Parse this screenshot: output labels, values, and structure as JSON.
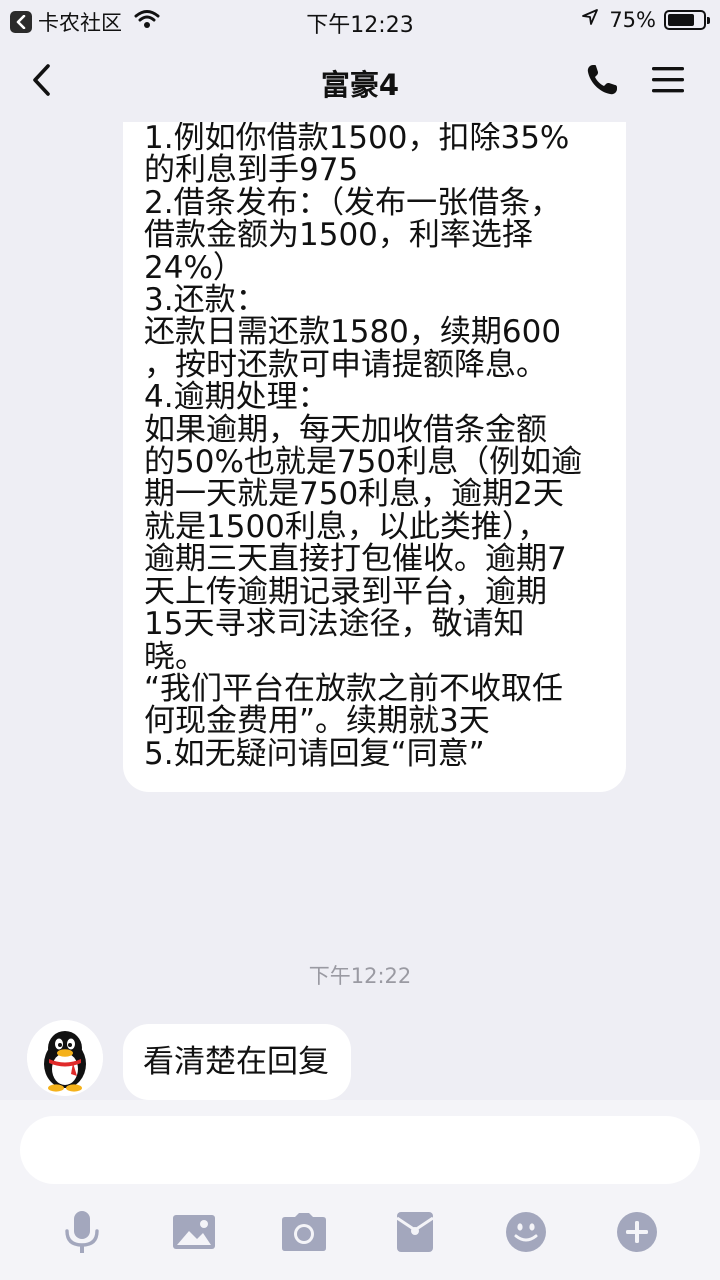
{
  "status_bar": {
    "carrier": "卡农社区",
    "time": "下午12:23",
    "battery_percent": "75%",
    "battery_level": 0.75
  },
  "nav": {
    "title": "富豪4",
    "back_icon": "chevron-left-icon",
    "call_icon": "phone-icon",
    "menu_icon": "menu-icon"
  },
  "messages": {
    "long_message_lines": [
      "1.例如你借款1500，扣除35%",
      "的利息到手975",
      "2.借条发布：（发布一张借条，",
      "借款金额为1500，利率选择",
      "24%）",
      "3.还款：",
      "还款日需还款1580，续期600",
      "，按时还款可申请提额降息。",
      "4.逾期处理：",
      "如果逾期，每天加收借条金额",
      "的50%也就是750利息（例如逾",
      "期一天就是750利息，逾期2天",
      "就是1500利息，以此类推），",
      "逾期三天直接打包催收。逾期7",
      "天上传逾期记录到平台，逾期",
      "15天寻求司法途径，敬请知",
      "晓。",
      "“我们平台在放款之前不收取任",
      "何现金费用”。续期就3天",
      "5.如无疑问请回复“同意”"
    ],
    "timestamp": "下午12:22",
    "short_message": "看清楚在回复"
  },
  "input": {
    "placeholder": ""
  },
  "toolbar_icons": [
    "microphone-icon",
    "image-icon",
    "camera-icon",
    "red-packet-icon",
    "emoji-icon",
    "plus-icon"
  ],
  "colors": {
    "background": "#eeeef4",
    "bubble": "#ffffff",
    "toolbar_icon": "#a3a7bd",
    "timestamp": "#9a9aa2"
  }
}
